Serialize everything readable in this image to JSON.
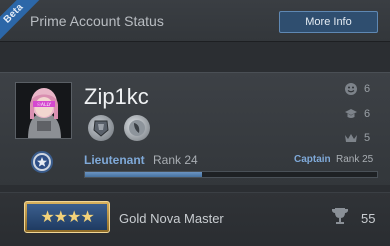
{
  "beta_label": "Beta",
  "prime": {
    "label": "Prime Account Status",
    "more_info_label": "More Info"
  },
  "profile": {
    "username": "Zip1kc",
    "avatar_tag": "☉ALLY",
    "stats": [
      {
        "icon": "smiley-icon",
        "value": "6"
      },
      {
        "icon": "graduation-cap-icon",
        "value": "6"
      },
      {
        "icon": "crown-icon",
        "value": "5"
      }
    ],
    "rank": {
      "name": "Lieutenant",
      "level_text": "Rank 24",
      "next_name": "Captain",
      "next_level_text": "Rank 25",
      "xp_progress": 0.4
    }
  },
  "competitive": {
    "skill_group": "Gold Nova Master",
    "badge_stars": "★★★★",
    "wins": "55"
  },
  "colors": {
    "accent_blue": "#7fa9d8",
    "button_bg": "#2f4e6f",
    "beta_ribbon": "#2c67a8",
    "gold": "#d8b15e"
  }
}
